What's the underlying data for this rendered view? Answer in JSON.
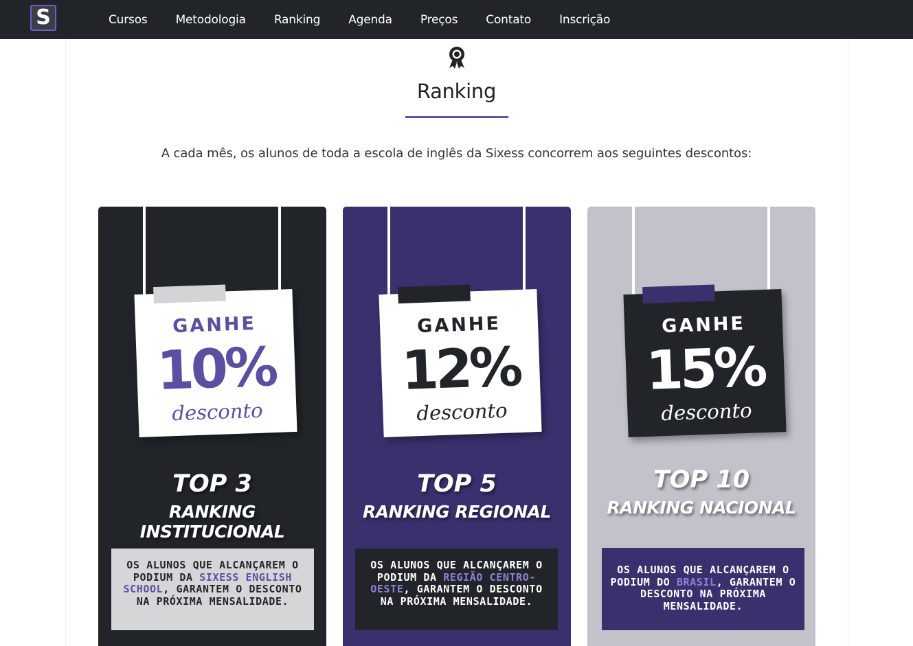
{
  "nav": {
    "logo": "S",
    "links": [
      "Cursos",
      "Metodologia",
      "Ranking",
      "Agenda",
      "Preços",
      "Contato",
      "Inscrição"
    ]
  },
  "section": {
    "icon": "award-icon",
    "title": "Ranking",
    "intro": "A cada mês, os alunos de toda a escola de inglês da Sixess concorrem aos seguintes descontos:"
  },
  "cards": [
    {
      "ganhe": "GANHE",
      "percent": "10%",
      "desconto": "desconto",
      "top": "TOP 3",
      "ranking": "RANKING INSTITUCIONAL",
      "desc_a": "OS ALUNOS QUE ALCANÇAREM O PODIUM DA ",
      "desc_highlight": "SIXESS ENGLISH SCHOOL",
      "desc_b": ", GARANTEM O DESCONTO NA PRÓXIMA MENSALIDADE.",
      "colors": {
        "card": "#212529",
        "note": "#ffffff",
        "tape": "#d4d4d6",
        "text": "#5a4fa0",
        "box": "#d6d6d8",
        "box_text": "#212529",
        "highlight": "#5a4fa0"
      }
    },
    {
      "ganhe": "GANHE",
      "percent": "12%",
      "desconto": "desconto",
      "top": "TOP 5",
      "ranking": "RANKING REGIONAL",
      "desc_a": "OS ALUNOS QUE ALCANÇAREM O PODIUM DA ",
      "desc_highlight": "REGIÃO CENTRO-OESTE",
      "desc_b": ", GARANTEM O DESCONTO NA PRÓXIMA MENSALIDADE.",
      "colors": {
        "card": "#3b306e",
        "note": "#ffffff",
        "tape": "#212529",
        "text": "#212529",
        "box": "#212529",
        "box_text": "#ffffff",
        "highlight": "#8d82d8"
      }
    },
    {
      "ganhe": "GANHE",
      "percent": "15%",
      "desconto": "desconto",
      "top": "TOP 10",
      "ranking": "RANKING NACIONAL",
      "desc_a": "OS ALUNOS QUE ALCANÇAREM O PODIUM DO ",
      "desc_highlight": "BRASIL",
      "desc_b": ", GARANTEM O DESCONTO NA PRÓXIMA MENSALIDADE.",
      "colors": {
        "card": "#c3c2cb",
        "note": "#212529",
        "tape": "#3b306e",
        "text": "#ffffff",
        "box": "#3b306e",
        "box_text": "#ffffff",
        "highlight": "#8d82d8"
      }
    }
  ]
}
